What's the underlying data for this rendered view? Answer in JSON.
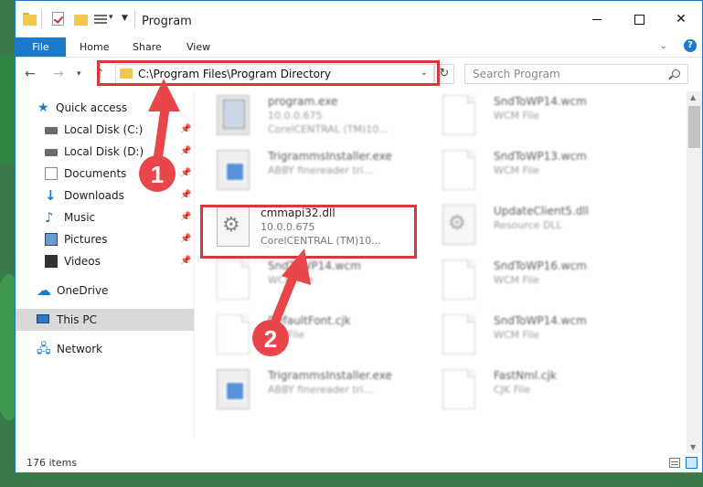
{
  "window": {
    "title": "Program"
  },
  "ribbon": {
    "tabs": [
      "File",
      "Home",
      "Share",
      "View"
    ]
  },
  "toolbar": {
    "back": "←",
    "forward": "→",
    "recent": "▾",
    "up": "↑",
    "refresh": "↻"
  },
  "address": {
    "path": "C:\\Program Files\\Program Directory"
  },
  "search": {
    "placeholder": "Search Program"
  },
  "nav": {
    "items": [
      {
        "label": "Quick access",
        "icon": "star-icon"
      },
      {
        "label": "Local Disk (C:)",
        "icon": "disk-icon",
        "pinned": true
      },
      {
        "label": "Local Disk (D:)",
        "icon": "disk-icon",
        "pinned": true
      },
      {
        "label": "Documents",
        "icon": "documents-icon",
        "pinned": true
      },
      {
        "label": "Downloads",
        "icon": "download-icon",
        "pinned": true
      },
      {
        "label": "Music",
        "icon": "music-icon",
        "pinned": true
      },
      {
        "label": "Pictures",
        "icon": "pictures-icon",
        "pinned": true
      },
      {
        "label": "Videos",
        "icon": "videos-icon",
        "pinned": true
      },
      {
        "label": "OneDrive",
        "icon": "cloud-icon"
      },
      {
        "label": "This PC",
        "icon": "computer-icon",
        "selected": true
      },
      {
        "label": "Network",
        "icon": "network-icon"
      }
    ]
  },
  "files": [
    {
      "name": "program.exe",
      "line1": "10.0.0.675",
      "line2": "CorelCENTRAL (TM)10...",
      "icon": "setup-icon",
      "blurred": true
    },
    {
      "name": "SndToWP14.wcm",
      "line1": "WCM File",
      "line2": "",
      "icon": "file-icon",
      "blurred": true
    },
    {
      "name": "TrigrammsInstaller.exe",
      "line1": "ABBY finereader tri...",
      "line2": "",
      "icon": "exe-icon",
      "blurred": true
    },
    {
      "name": "SndToWP13.wcm",
      "line1": "WCM File",
      "line2": "",
      "icon": "file-icon",
      "blurred": true
    },
    {
      "name": "cmmapi32.dll",
      "line1": "10.0.0.675",
      "line2": "CorelCENTRAL (TM)10...",
      "icon": "dll-gear-icon",
      "blurred": false
    },
    {
      "name": "UpdateClient5.dll",
      "line1": "Resource DLL",
      "line2": "",
      "icon": "dll-gear-icon",
      "blurred": true
    },
    {
      "name": "SndToWP14.wcm",
      "line1": "WCM File",
      "line2": "",
      "icon": "file-icon",
      "blurred": true
    },
    {
      "name": "SndToWP16.wcm",
      "line1": "WCM File",
      "line2": "",
      "icon": "file-icon",
      "blurred": true
    },
    {
      "name": "DefaultFont.cjk",
      "line1": "CJK File",
      "line2": "",
      "icon": "file-icon",
      "blurred": true
    },
    {
      "name": "SndToWP14.wcm",
      "line1": "WCM File",
      "line2": "",
      "icon": "file-icon",
      "blurred": true
    },
    {
      "name": "TrigrammsInstaller.exe",
      "line1": "ABBY finereader tri...",
      "line2": "",
      "icon": "exe-icon",
      "blurred": true
    },
    {
      "name": "FastNml.cjk",
      "line1": "CJK File",
      "line2": "",
      "icon": "file-icon",
      "blurred": true
    }
  ],
  "status": {
    "count": "176 items"
  },
  "annotations": {
    "step1": "1",
    "step2": "2",
    "highlight_color": "#d9373a",
    "arrow_color": "#e8464a"
  },
  "colors": {
    "accent": "#1979ca",
    "folder": "#f3c74d"
  }
}
